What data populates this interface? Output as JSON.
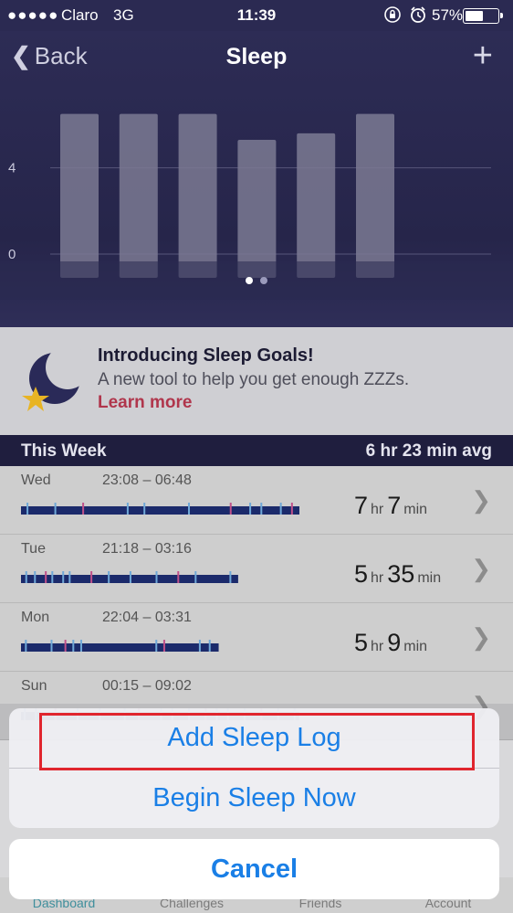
{
  "status_bar": {
    "signal": "●●●●●",
    "carrier": "Claro",
    "network": "3G",
    "time": "11:39",
    "battery_pct": "57%",
    "battery_level": 0.57
  },
  "nav": {
    "back_label": "Back",
    "title": "Sleep",
    "add_label": "+"
  },
  "chart_data": {
    "type": "bar",
    "categories": [
      "",
      "",
      "",
      "",
      "",
      ""
    ],
    "values": [
      6.5,
      6.5,
      6.5,
      5.3,
      5.6,
      6.5
    ],
    "ylim": [
      0,
      7.8
    ],
    "yticks": [
      0,
      4
    ],
    "ytick_labels": [
      "0",
      "4"
    ],
    "grid": true,
    "page_dots": 2,
    "active_dot": 0,
    "colors": {
      "bar": "#7b7a93",
      "grid": "#56557a",
      "label": "#c9c9dc"
    }
  },
  "promo": {
    "title": "Introducing Sleep Goals!",
    "description": "A new tool to help you get enough ZZZs.",
    "link": "Learn more"
  },
  "week": {
    "label": "This Week",
    "avg": "6 hr 23 min avg"
  },
  "logs": [
    {
      "day": "Wed",
      "range": "23:08 – 06:48",
      "hours": "7",
      "hr_unit": "hr",
      "minutes": "7",
      "min_unit": "min",
      "bar_fraction": 1.0
    },
    {
      "day": "Tue",
      "range": "21:18 – 03:16",
      "hours": "5",
      "hr_unit": "hr",
      "minutes": "35",
      "min_unit": "min",
      "bar_fraction": 0.78
    },
    {
      "day": "Mon",
      "range": "22:04 – 03:31",
      "hours": "5",
      "hr_unit": "hr",
      "minutes": "9",
      "min_unit": "min",
      "bar_fraction": 0.71
    },
    {
      "day": "Sun",
      "range": "00:15 – 09:02",
      "hours": "",
      "hr_unit": "",
      "minutes": "",
      "min_unit": "",
      "bar_fraction": 1.0
    }
  ],
  "tabs": [
    "Dashboard",
    "Challenges",
    "Friends",
    "Account"
  ],
  "action_sheet": {
    "add_sleep_log": "Add Sleep Log",
    "begin_sleep_now": "Begin Sleep Now",
    "cancel": "Cancel"
  },
  "colors": {
    "accent_blue": "#1a7fe6",
    "highlight_red": "#e0252e",
    "header_bg": "#2b2a52",
    "link_red": "#b0364c",
    "sleep_bar": "#1b2a6b"
  },
  "icons": {
    "back": "chevron-left-icon",
    "add": "plus-icon",
    "row_chevron": "chevron-right-icon",
    "promo": "moon-star-icon",
    "lock": "rotation-lock-icon",
    "alarm": "alarm-icon"
  }
}
